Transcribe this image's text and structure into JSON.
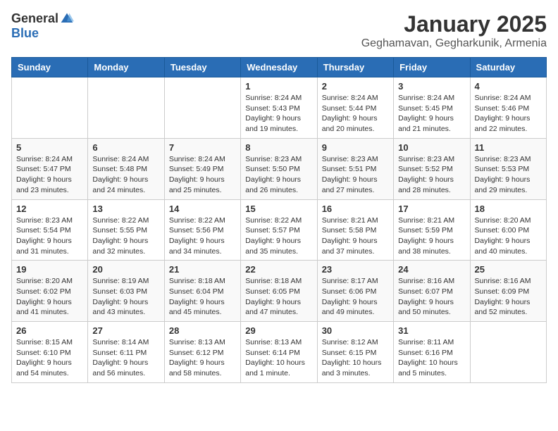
{
  "header": {
    "logo_general": "General",
    "logo_blue": "Blue",
    "month_title": "January 2025",
    "subtitle": "Geghamavan, Gegharkunik, Armenia"
  },
  "weekdays": [
    "Sunday",
    "Monday",
    "Tuesday",
    "Wednesday",
    "Thursday",
    "Friday",
    "Saturday"
  ],
  "weeks": [
    [
      {
        "day": "",
        "info": ""
      },
      {
        "day": "",
        "info": ""
      },
      {
        "day": "",
        "info": ""
      },
      {
        "day": "1",
        "info": "Sunrise: 8:24 AM\nSunset: 5:43 PM\nDaylight: 9 hours\nand 19 minutes."
      },
      {
        "day": "2",
        "info": "Sunrise: 8:24 AM\nSunset: 5:44 PM\nDaylight: 9 hours\nand 20 minutes."
      },
      {
        "day": "3",
        "info": "Sunrise: 8:24 AM\nSunset: 5:45 PM\nDaylight: 9 hours\nand 21 minutes."
      },
      {
        "day": "4",
        "info": "Sunrise: 8:24 AM\nSunset: 5:46 PM\nDaylight: 9 hours\nand 22 minutes."
      }
    ],
    [
      {
        "day": "5",
        "info": "Sunrise: 8:24 AM\nSunset: 5:47 PM\nDaylight: 9 hours\nand 23 minutes."
      },
      {
        "day": "6",
        "info": "Sunrise: 8:24 AM\nSunset: 5:48 PM\nDaylight: 9 hours\nand 24 minutes."
      },
      {
        "day": "7",
        "info": "Sunrise: 8:24 AM\nSunset: 5:49 PM\nDaylight: 9 hours\nand 25 minutes."
      },
      {
        "day": "8",
        "info": "Sunrise: 8:23 AM\nSunset: 5:50 PM\nDaylight: 9 hours\nand 26 minutes."
      },
      {
        "day": "9",
        "info": "Sunrise: 8:23 AM\nSunset: 5:51 PM\nDaylight: 9 hours\nand 27 minutes."
      },
      {
        "day": "10",
        "info": "Sunrise: 8:23 AM\nSunset: 5:52 PM\nDaylight: 9 hours\nand 28 minutes."
      },
      {
        "day": "11",
        "info": "Sunrise: 8:23 AM\nSunset: 5:53 PM\nDaylight: 9 hours\nand 29 minutes."
      }
    ],
    [
      {
        "day": "12",
        "info": "Sunrise: 8:23 AM\nSunset: 5:54 PM\nDaylight: 9 hours\nand 31 minutes."
      },
      {
        "day": "13",
        "info": "Sunrise: 8:22 AM\nSunset: 5:55 PM\nDaylight: 9 hours\nand 32 minutes."
      },
      {
        "day": "14",
        "info": "Sunrise: 8:22 AM\nSunset: 5:56 PM\nDaylight: 9 hours\nand 34 minutes."
      },
      {
        "day": "15",
        "info": "Sunrise: 8:22 AM\nSunset: 5:57 PM\nDaylight: 9 hours\nand 35 minutes."
      },
      {
        "day": "16",
        "info": "Sunrise: 8:21 AM\nSunset: 5:58 PM\nDaylight: 9 hours\nand 37 minutes."
      },
      {
        "day": "17",
        "info": "Sunrise: 8:21 AM\nSunset: 5:59 PM\nDaylight: 9 hours\nand 38 minutes."
      },
      {
        "day": "18",
        "info": "Sunrise: 8:20 AM\nSunset: 6:00 PM\nDaylight: 9 hours\nand 40 minutes."
      }
    ],
    [
      {
        "day": "19",
        "info": "Sunrise: 8:20 AM\nSunset: 6:02 PM\nDaylight: 9 hours\nand 41 minutes."
      },
      {
        "day": "20",
        "info": "Sunrise: 8:19 AM\nSunset: 6:03 PM\nDaylight: 9 hours\nand 43 minutes."
      },
      {
        "day": "21",
        "info": "Sunrise: 8:18 AM\nSunset: 6:04 PM\nDaylight: 9 hours\nand 45 minutes."
      },
      {
        "day": "22",
        "info": "Sunrise: 8:18 AM\nSunset: 6:05 PM\nDaylight: 9 hours\nand 47 minutes."
      },
      {
        "day": "23",
        "info": "Sunrise: 8:17 AM\nSunset: 6:06 PM\nDaylight: 9 hours\nand 49 minutes."
      },
      {
        "day": "24",
        "info": "Sunrise: 8:16 AM\nSunset: 6:07 PM\nDaylight: 9 hours\nand 50 minutes."
      },
      {
        "day": "25",
        "info": "Sunrise: 8:16 AM\nSunset: 6:09 PM\nDaylight: 9 hours\nand 52 minutes."
      }
    ],
    [
      {
        "day": "26",
        "info": "Sunrise: 8:15 AM\nSunset: 6:10 PM\nDaylight: 9 hours\nand 54 minutes."
      },
      {
        "day": "27",
        "info": "Sunrise: 8:14 AM\nSunset: 6:11 PM\nDaylight: 9 hours\nand 56 minutes."
      },
      {
        "day": "28",
        "info": "Sunrise: 8:13 AM\nSunset: 6:12 PM\nDaylight: 9 hours\nand 58 minutes."
      },
      {
        "day": "29",
        "info": "Sunrise: 8:13 AM\nSunset: 6:14 PM\nDaylight: 10 hours\nand 1 minute."
      },
      {
        "day": "30",
        "info": "Sunrise: 8:12 AM\nSunset: 6:15 PM\nDaylight: 10 hours\nand 3 minutes."
      },
      {
        "day": "31",
        "info": "Sunrise: 8:11 AM\nSunset: 6:16 PM\nDaylight: 10 hours\nand 5 minutes."
      },
      {
        "day": "",
        "info": ""
      }
    ]
  ]
}
